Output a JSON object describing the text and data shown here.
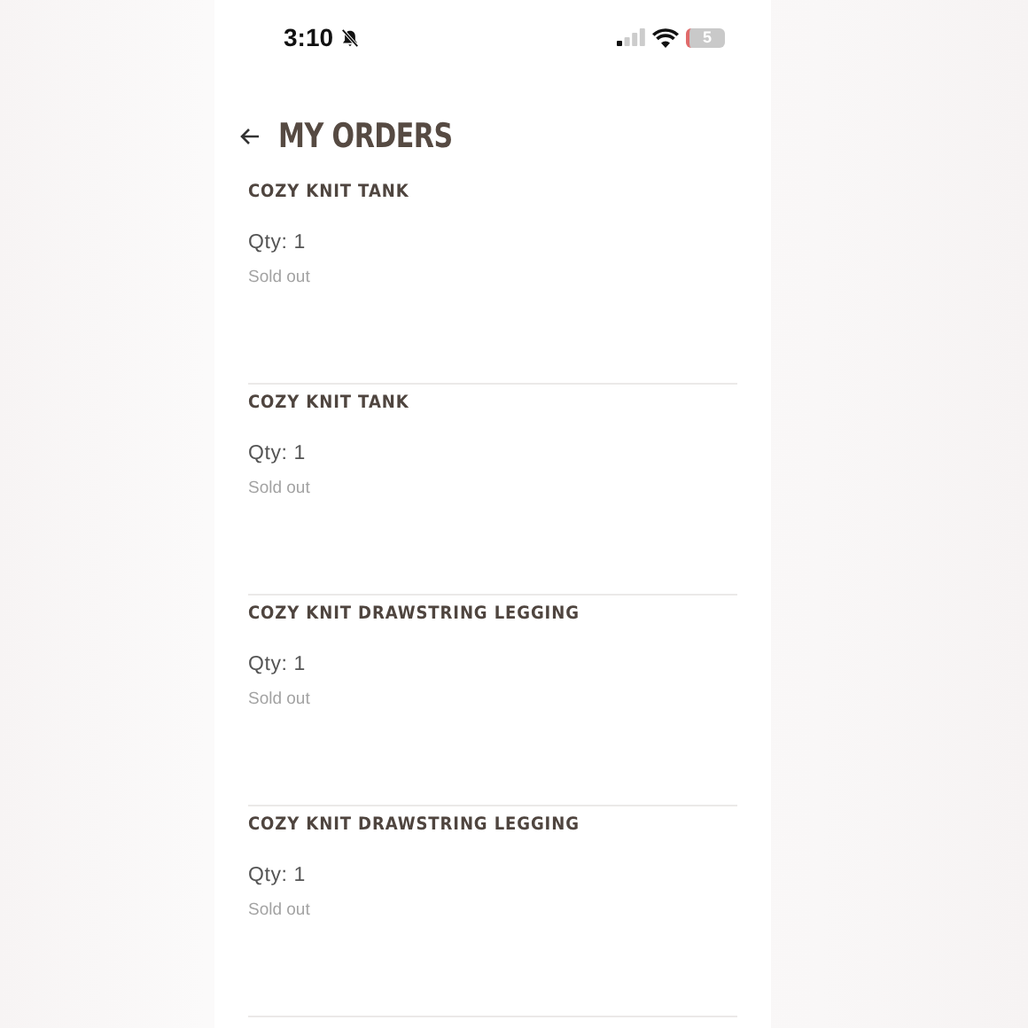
{
  "status_bar": {
    "time": "3:10",
    "battery": "5"
  },
  "header": {
    "title": "MY ORDERS"
  },
  "orders": [
    {
      "name": "COZY KNIT TANK",
      "qty": "Qty: 1",
      "status": "Sold out"
    },
    {
      "name": "COZY KNIT TANK",
      "qty": "Qty: 1",
      "status": "Sold out"
    },
    {
      "name": "COZY KNIT DRAWSTRING LEGGING",
      "qty": "Qty: 1",
      "status": "Sold out"
    },
    {
      "name": "COZY KNIT DRAWSTRING LEGGING",
      "qty": "Qty: 1",
      "status": "Sold out"
    }
  ]
}
